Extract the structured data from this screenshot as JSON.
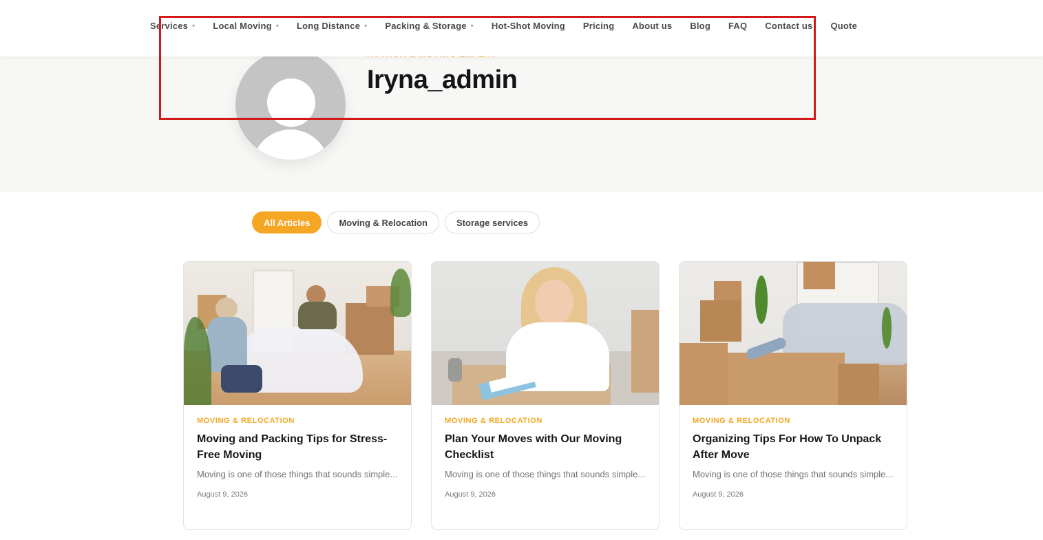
{
  "nav": {
    "items": [
      {
        "label": "Services",
        "dropdown": true
      },
      {
        "label": "Local Moving",
        "dropdown": true
      },
      {
        "label": "Long Distance",
        "dropdown": true
      },
      {
        "label": "Packing & Storage",
        "dropdown": true
      },
      {
        "label": "Hot-Shot Moving",
        "dropdown": false
      },
      {
        "label": "Pricing",
        "dropdown": false
      },
      {
        "label": "About us",
        "dropdown": false
      },
      {
        "label": "Blog",
        "dropdown": false
      },
      {
        "label": "FAQ",
        "dropdown": false
      },
      {
        "label": "Contact us",
        "dropdown": false
      },
      {
        "label": "Quote",
        "dropdown": false
      }
    ]
  },
  "author": {
    "role": "AUTHOR & MOVING EXPERT",
    "name": "Iryna_admin"
  },
  "filters": [
    {
      "label": "All Articles",
      "active": true
    },
    {
      "label": "Moving & Relocation",
      "active": false
    },
    {
      "label": "Storage services",
      "active": false
    }
  ],
  "articles": [
    {
      "category": "MOVING & RELOCATION",
      "title": "Moving and Packing Tips for Stress-Free Moving",
      "excerpt": "Moving is one of those things that sounds simple...",
      "date": "August 9, 2026"
    },
    {
      "category": "MOVING & RELOCATION",
      "title": "Plan Your Moves with Our Moving Checklist",
      "excerpt": "Moving is one of those things that sounds simple...",
      "date": "August 9, 2026"
    },
    {
      "category": "MOVING & RELOCATION",
      "title": "Organizing Tips For How To Unpack After Move",
      "excerpt": "Moving is one of those things that sounds simple...",
      "date": "August 9, 2026"
    }
  ],
  "colors": {
    "accent": "#f5a623",
    "highlight": "#d21a1a",
    "hero_bg": "#f7f7f5"
  }
}
